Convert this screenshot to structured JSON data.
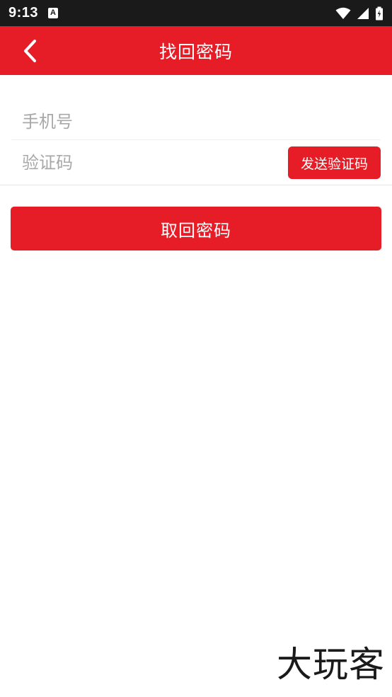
{
  "status_bar": {
    "time": "9:13",
    "notification_icon": "A"
  },
  "app_bar": {
    "title": "找回密码",
    "back_icon": "chevron-left-icon"
  },
  "form": {
    "phone_placeholder": "手机号",
    "code_placeholder": "验证码",
    "send_code_label": "发送验证码"
  },
  "submit_label": "取回密码",
  "watermark": "大玩客",
  "colors": {
    "brand_red": "#e61d26",
    "status_bar": "#1a1a1a",
    "placeholder": "#a8a8a8"
  }
}
